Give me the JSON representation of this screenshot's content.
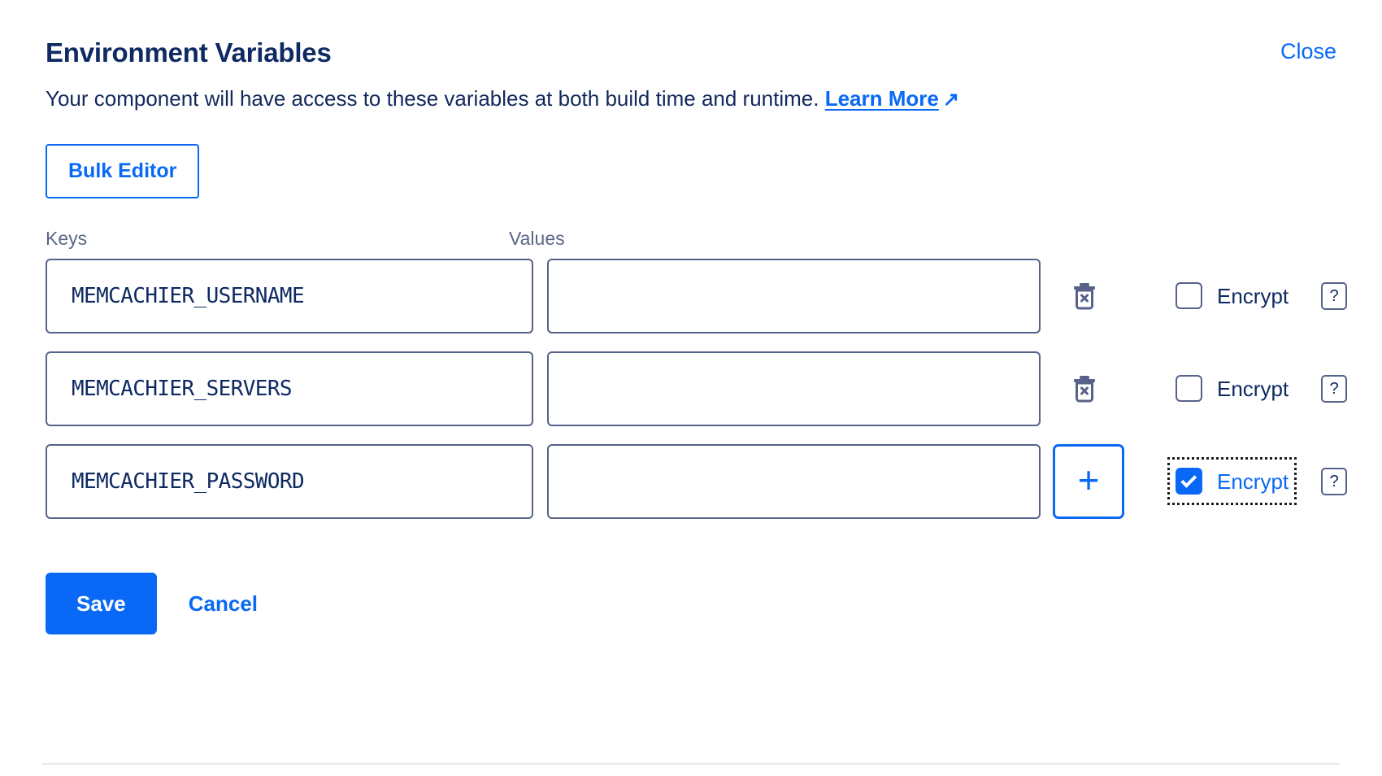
{
  "header": {
    "title": "Environment Variables",
    "close_label": "Close"
  },
  "description": {
    "text_before_link": "Your component will have access to these variables at both build time and runtime. ",
    "link_label": "Learn More",
    "link_arrow": "↗"
  },
  "toolbar": {
    "bulk_editor_label": "Bulk Editor"
  },
  "table": {
    "headers": {
      "keys": "Keys",
      "values": "Values"
    },
    "rows": [
      {
        "key": "MEMCACHIER_USERNAME",
        "value": "",
        "value_placeholder": "",
        "action": "delete",
        "action_label": "✕",
        "encrypt_label": "Encrypt",
        "encrypt_checked": false,
        "encrypt_focused": false,
        "help_label": "?"
      },
      {
        "key": "MEMCACHIER_SERVERS",
        "value": "",
        "value_placeholder": "",
        "action": "delete",
        "action_label": "✕",
        "encrypt_label": "Encrypt",
        "encrypt_checked": false,
        "encrypt_focused": false,
        "help_label": "?"
      },
      {
        "key": "MEMCACHIER_PASSWORD",
        "value": "",
        "value_placeholder": "",
        "action": "add",
        "action_label": "+",
        "encrypt_label": "Encrypt",
        "encrypt_checked": true,
        "encrypt_focused": true,
        "help_label": "?"
      }
    ]
  },
  "footer": {
    "save_label": "Save",
    "cancel_label": "Cancel"
  },
  "colors": {
    "accent_blue": "#0969f6",
    "title_navy": "#0e2a62",
    "border_slate": "#56628a",
    "muted_label": "#5a6785",
    "divider": "#e4e9f0"
  }
}
